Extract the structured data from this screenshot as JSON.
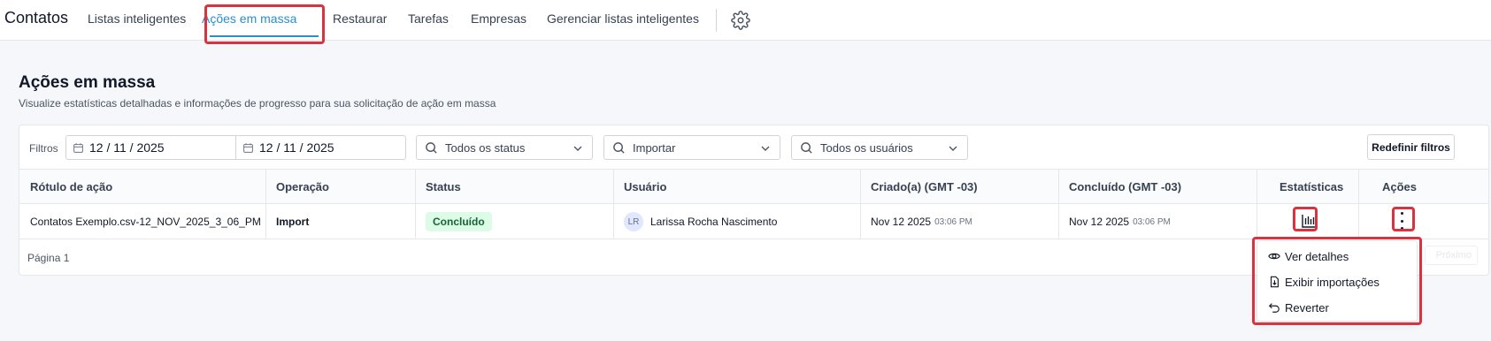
{
  "app": {
    "title": "Contatos"
  },
  "nav": {
    "tabs": [
      {
        "label": "Listas inteligentes"
      },
      {
        "label": "Ações em massa",
        "active": true
      },
      {
        "label": "Restaurar"
      },
      {
        "label": "Tarefas"
      },
      {
        "label": "Empresas"
      },
      {
        "label": "Gerenciar listas inteligentes"
      }
    ],
    "settings_icon": "gear-icon"
  },
  "page": {
    "title": "Ações em massa",
    "subtitle": "Visualize estatísticas detalhadas e informações de progresso para sua solicitação de ação em massa"
  },
  "filters": {
    "label": "Filtros",
    "date_from": "12 / 11 / 2025",
    "date_to": "12 / 11 / 2025",
    "status": "Todos os status",
    "operation": "Importar",
    "users": "Todos os usuários",
    "reset_label": "Redefinir filtros"
  },
  "table": {
    "columns": [
      "Rótulo de ação",
      "Operação",
      "Status",
      "Usuário",
      "Criado(a) (GMT -03)",
      "Concluído (GMT -03)",
      "Estatísticas",
      "Ações"
    ],
    "rows": [
      {
        "label": "Contatos Exemplo.csv-12_NOV_2025_3_06_PM",
        "operation": "Import",
        "status": "Concluído",
        "user_initials": "LR",
        "user": "Larissa Rocha Nascimento",
        "created_date": "Nov 12 2025",
        "created_time": "03:06 PM",
        "completed_date": "Nov 12 2025",
        "completed_time": "03:06 PM"
      }
    ],
    "pagination": "Página 1",
    "next_label": "Próximo"
  },
  "actions_menu": {
    "items": [
      {
        "label": "Ver detalhes",
        "icon": "eye-icon"
      },
      {
        "label": "Exibir importações",
        "icon": "file-import-icon"
      },
      {
        "label": "Reverter",
        "icon": "undo-icon"
      }
    ]
  },
  "colors": {
    "accent": "#2b8fc9",
    "highlight": "#d93340",
    "status_success_bg": "#dcfce7",
    "status_success_text": "#166534"
  }
}
